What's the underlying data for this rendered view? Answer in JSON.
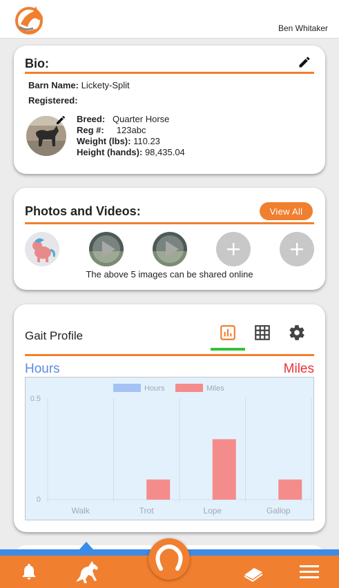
{
  "header": {
    "user_name": "Ben Whitaker"
  },
  "bio": {
    "title": "Bio:",
    "barn_name_label": "Barn Name:",
    "barn_name": "Lickety-Split",
    "registered_label": "Registered:",
    "breed_label": "Breed:",
    "breed": "Quarter Horse",
    "reg_label": "Reg #:",
    "reg": "123abc",
    "weight_label": "Weight (lbs):",
    "weight": "110.23",
    "height_label": "Height (hands):",
    "height": "98,435.04"
  },
  "photos": {
    "title": "Photos and Videos:",
    "view_all_label": "View All",
    "note": "The above 5 images can be shared online",
    "items": [
      "toy-photo",
      "video-thumbnail",
      "video-thumbnail",
      "add-photo",
      "add-photo"
    ]
  },
  "gait": {
    "title": "Gait Profile",
    "tabs": [
      "bar-chart-icon",
      "grid-icon",
      "gear-icon"
    ],
    "active_tab": "bar-chart-icon",
    "hours_label": "Hours",
    "miles_label": "Miles"
  },
  "chart_data": {
    "type": "bar",
    "categories": [
      "Walk",
      "Trot",
      "Lope",
      "Gallop"
    ],
    "series": [
      {
        "name": "Hours",
        "values": [
          0,
          0,
          0,
          0
        ],
        "color": "#a4c2f4"
      },
      {
        "name": "Miles",
        "values": [
          0,
          0.1,
          0.3,
          0.1
        ],
        "color": "#f48c8c"
      }
    ],
    "yticks": [
      "0",
      "0.5"
    ],
    "ylim": [
      0,
      0.5
    ],
    "legend": "top-center",
    "grid": true
  },
  "colors": {
    "accent": "#f07f2f",
    "blue_bar": "#3c8be6",
    "hours": "#5b8ae8",
    "miles": "#e8323a",
    "active_tab": "#34c33a"
  },
  "nav": {
    "items": [
      "bell-icon",
      "horse-icon",
      "horseshoe-icon",
      "book-icon",
      "menu-icon"
    ],
    "active": "horse-icon"
  }
}
